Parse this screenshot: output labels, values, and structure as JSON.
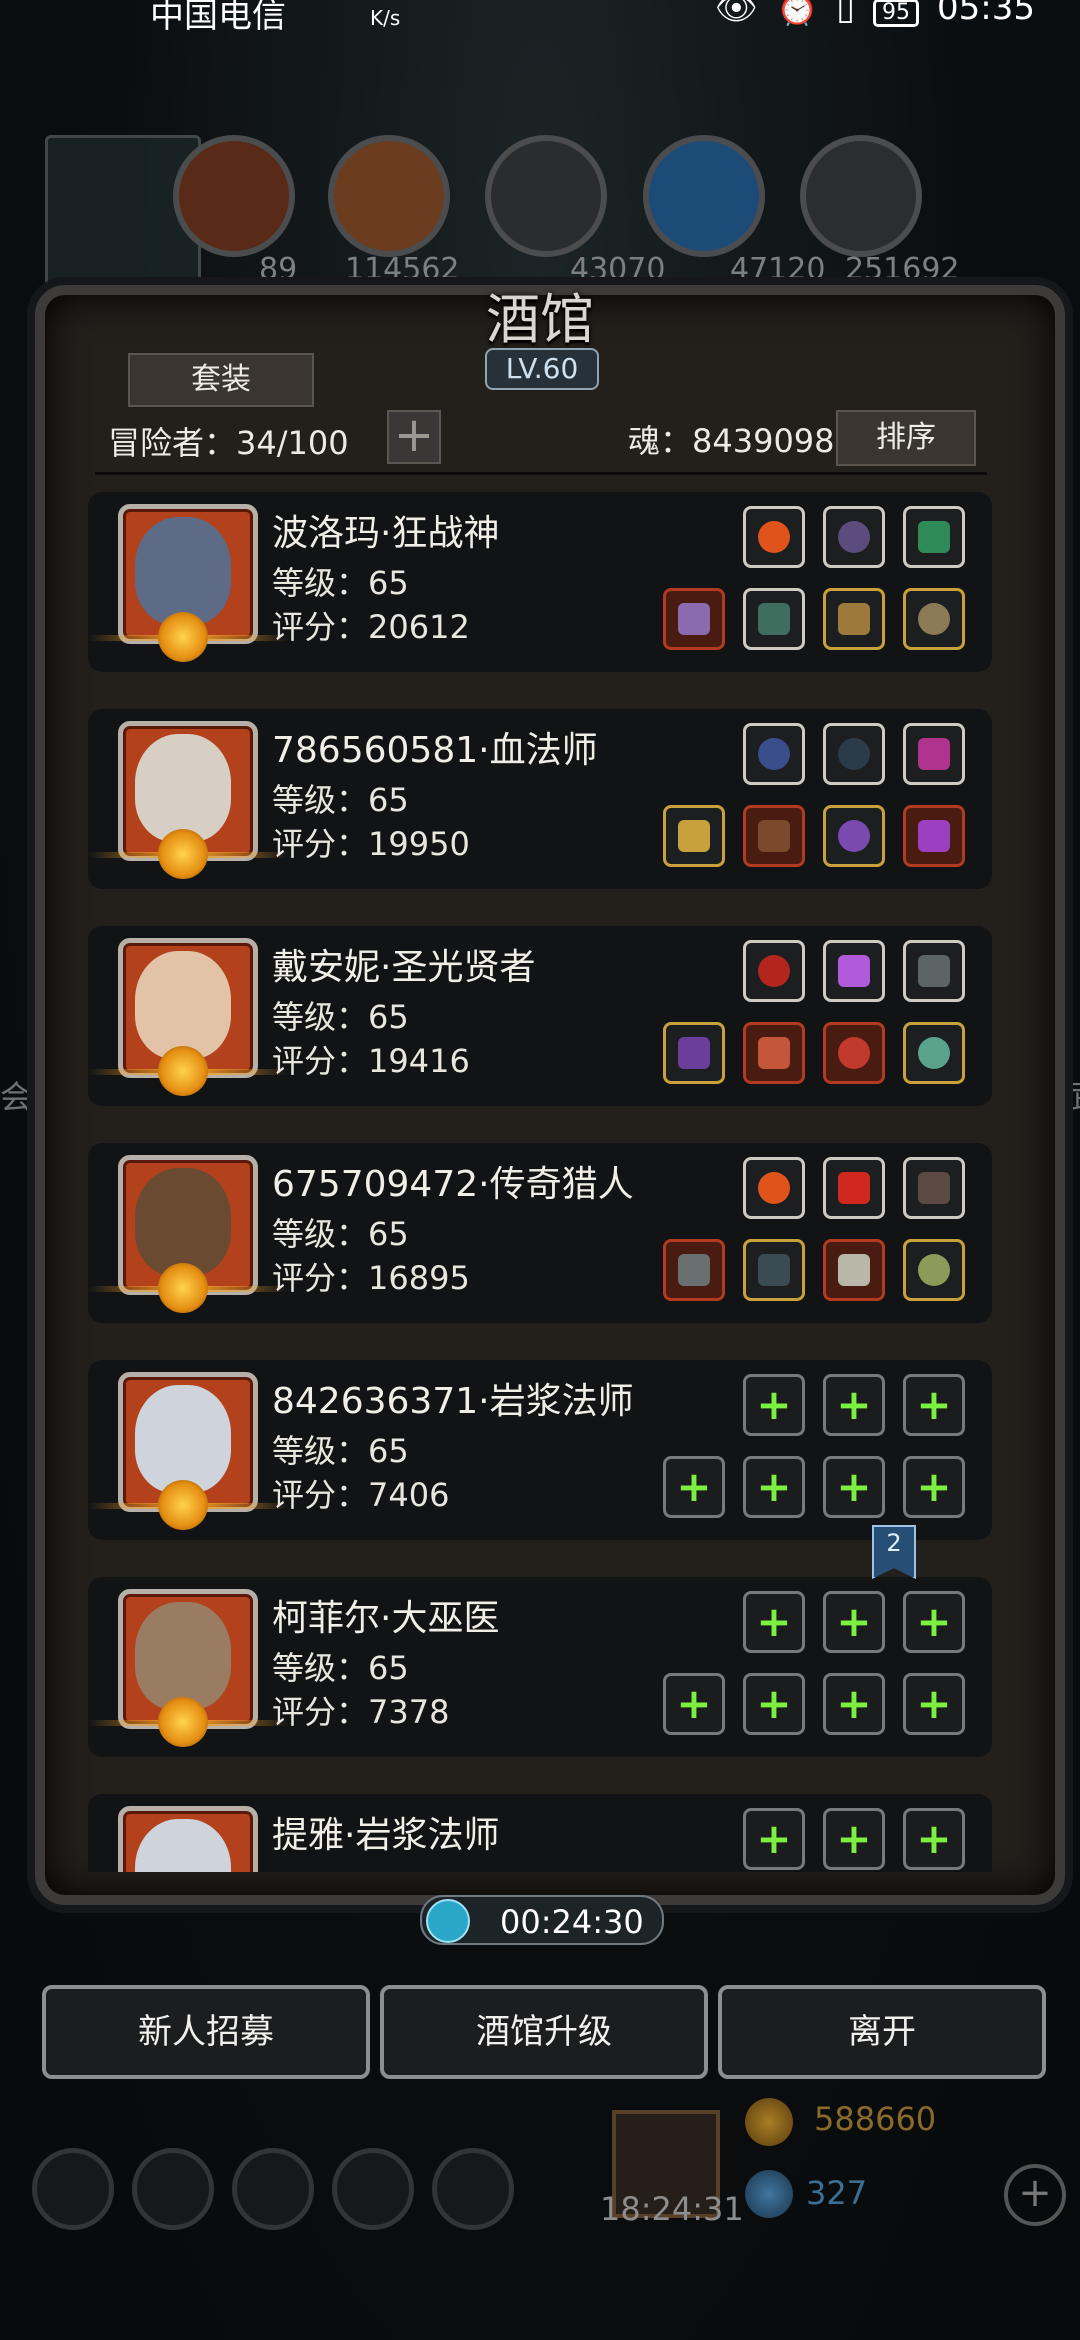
{
  "status": {
    "carrier": "中国电信",
    "net": "K/s",
    "battery": "95",
    "time": "05:35"
  },
  "top_resources": [
    {
      "name": "leather",
      "value": "89"
    },
    {
      "name": "wood",
      "value": "114562"
    },
    {
      "name": "ore",
      "value": "43070"
    },
    {
      "name": "crystal",
      "value": "47120"
    },
    {
      "name": "iron",
      "value": "251692"
    }
  ],
  "panel": {
    "title": "酒馆",
    "level": "LV.60",
    "suit_button": "套装",
    "adventurers": "冒险者：34/100",
    "soul": "魂：8439098",
    "sort_button": "排序"
  },
  "heroes": [
    {
      "name": "波洛玛·狂战神",
      "level": "等级：65",
      "score": "评分：20612",
      "avatar_color": "#b5451e"
    },
    {
      "name": "786560581·血法师",
      "level": "等级：65",
      "score": "评分：19950",
      "avatar_color": "#b5451e"
    },
    {
      "name": "戴安妮·圣光贤者",
      "level": "等级：65",
      "score": "评分：19416",
      "avatar_color": "#b5451e"
    },
    {
      "name": "675709472·传奇猎人",
      "level": "等级：65",
      "score": "评分：16895",
      "avatar_color": "#b5451e"
    },
    {
      "name": "842636371·岩浆法师",
      "level": "等级：65",
      "score": "评分：7406",
      "avatar_color": "#b5451e"
    },
    {
      "name": "柯菲尔·大巫医",
      "level": "等级：65",
      "score": "评分：7378",
      "avatar_color": "#b5451e"
    },
    {
      "name": "提雅·岩浆法师",
      "level": "",
      "score": "",
      "avatar_color": "#b5451e"
    }
  ],
  "notification_badge": "2",
  "timer": "00:24:30",
  "buttons": {
    "recruit": "新人招募",
    "upgrade": "酒馆升级",
    "leave": "离开"
  },
  "footer": {
    "gift_time": "18:24:31",
    "gold": "588660",
    "gems": "327",
    "left_hint": "会",
    "right_hint": "武"
  }
}
